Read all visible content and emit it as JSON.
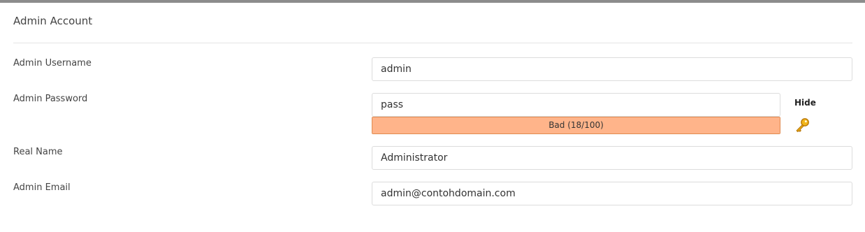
{
  "section": {
    "title": "Admin Account"
  },
  "form": {
    "username": {
      "label": "Admin Username",
      "value": "admin"
    },
    "password": {
      "label": "Admin Password",
      "value": "pass",
      "toggle_label": "Hide",
      "generate_icon": "key-icon",
      "strength_text": "Bad (18/100)",
      "strength_fill": 1.0,
      "strength_color": "#ffb48a"
    },
    "real_name": {
      "label": "Real Name",
      "value": "Administrator"
    },
    "email": {
      "label": "Admin Email",
      "value": "admin@contohdomain.com"
    }
  }
}
